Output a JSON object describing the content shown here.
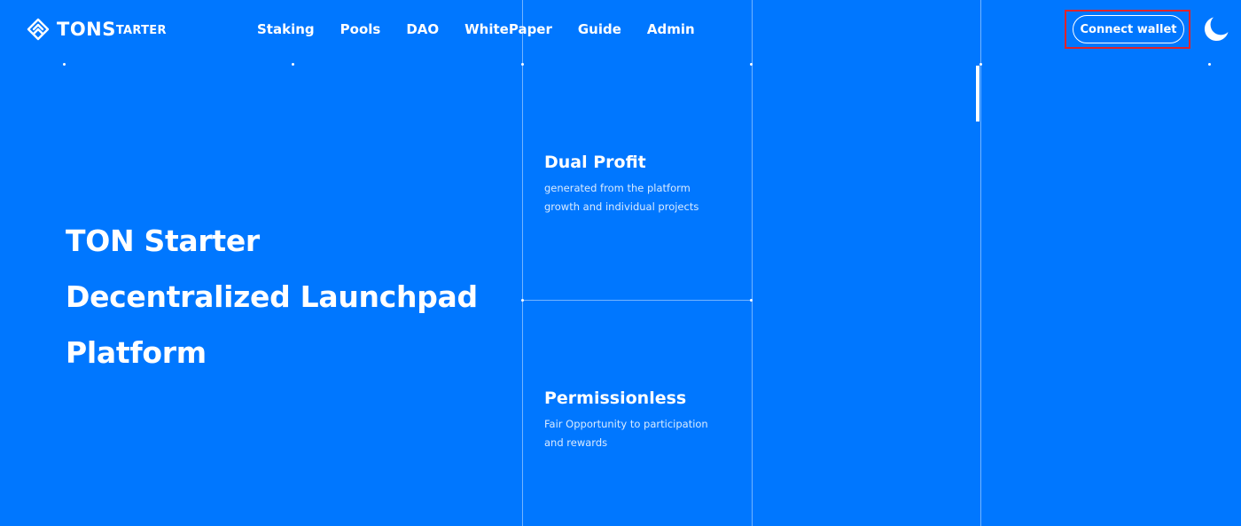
{
  "brand": {
    "logo_icon": "tonstarter-logo-icon",
    "name_main": "TONS",
    "name_sub": "TARTER"
  },
  "nav": {
    "items": [
      {
        "label": "Staking"
      },
      {
        "label": "Pools"
      },
      {
        "label": "DAO"
      },
      {
        "label": "WhitePaper"
      },
      {
        "label": "Guide"
      },
      {
        "label": "Admin"
      }
    ]
  },
  "header": {
    "connect_wallet_label": "Connect wallet",
    "theme_toggle_icon": "moon-icon"
  },
  "hero": {
    "lines": [
      "TON Starter",
      "Decentralized Launchpad",
      "Platform"
    ]
  },
  "features": [
    {
      "title": "Dual Profit",
      "desc_line1": "generated from the platform",
      "desc_line2": "growth and individual projects"
    },
    {
      "title": "Permissionless",
      "desc_line1": "Fair Opportunity to participation",
      "desc_line2": "and rewards"
    }
  ],
  "colors": {
    "background": "#0077ff",
    "text": "#ffffff",
    "highlight_border": "#e0232b"
  }
}
